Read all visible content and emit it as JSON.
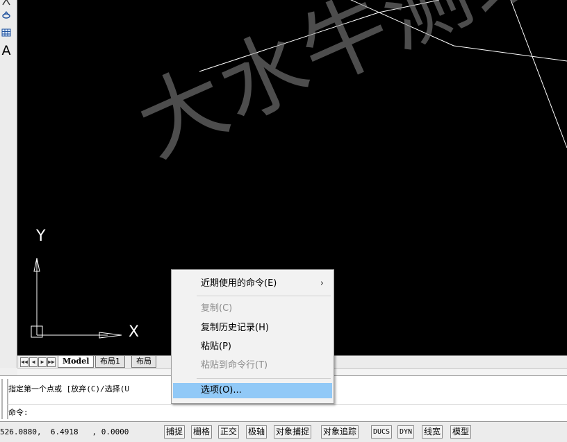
{
  "left_toolbar": {
    "text_tool_label": "A"
  },
  "axis": {
    "y_label": "Y",
    "x_label": "X"
  },
  "watermark": {
    "text": "大水牛测绘"
  },
  "layout_tabs": {
    "nav_buttons": [
      "◀◀",
      "◀",
      "▶",
      "▶▶"
    ],
    "tabs": [
      {
        "label": "Model"
      },
      {
        "label": "布局1"
      },
      {
        "label": "布局"
      }
    ]
  },
  "command": {
    "history_line": "指定第一个点或 [放弃(C)/选择(U",
    "prompt_line": "命令:"
  },
  "status_bar": {
    "coordinates": "526.0880,  6.4918   , 0.0000",
    "buttons": [
      "捕捉",
      "栅格",
      "正交",
      "极轴",
      "对象捕捉",
      "对象追踪",
      "DUCS",
      "DYN",
      "线宽",
      "模型"
    ]
  },
  "context_menu": {
    "items": [
      {
        "label": "近期使用的命令(E)",
        "has_submenu": true,
        "arrow": "›",
        "state": "enabled"
      },
      {
        "label": "复制(C)",
        "state": "disabled"
      },
      {
        "label": "复制历史记录(H)",
        "state": "enabled"
      },
      {
        "label": "粘贴(P)",
        "state": "enabled"
      },
      {
        "label": "粘贴到命令行(T)",
        "state": "disabled"
      },
      {
        "label": "选项(O)...",
        "state": "highlighted"
      }
    ]
  },
  "colors": {
    "canvas_bg": "#000000",
    "drawing_lines": "#ffffff",
    "menu_highlight": "#91c9f7",
    "watermark": "#8c8c8c"
  }
}
